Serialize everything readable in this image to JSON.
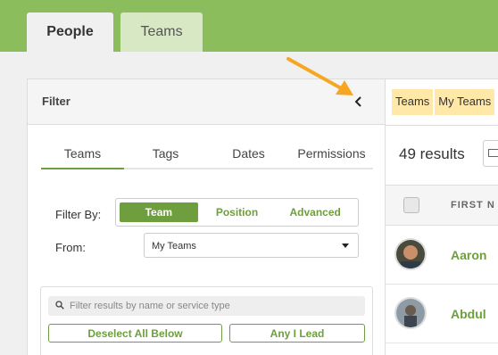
{
  "main_tabs": [
    {
      "label": "People",
      "active": true
    },
    {
      "label": "Teams",
      "active": false
    }
  ],
  "filter": {
    "title": "Filter",
    "subtabs": [
      "Teams",
      "Tags",
      "Dates",
      "Permissions"
    ],
    "filter_by_label": "Filter By:",
    "filter_by_options": [
      "Team",
      "Position",
      "Advanced"
    ],
    "from_label": "From:",
    "from_value": "My Teams",
    "search_placeholder": "Filter results by name or service type",
    "deselect_label": "Deselect All Below",
    "any_lead_label": "Any I Lead"
  },
  "results": {
    "badges": [
      "Teams",
      "My Teams"
    ],
    "count_text": "49 results",
    "column_header": "FIRST N",
    "people": [
      "Aaron",
      "Abdul"
    ]
  },
  "colors": {
    "brand_green": "#6e9e3d",
    "topbar_green": "#8cbd5c",
    "badge_yellow": "#ffe8a8",
    "annotation_arrow": "#f5a623"
  }
}
